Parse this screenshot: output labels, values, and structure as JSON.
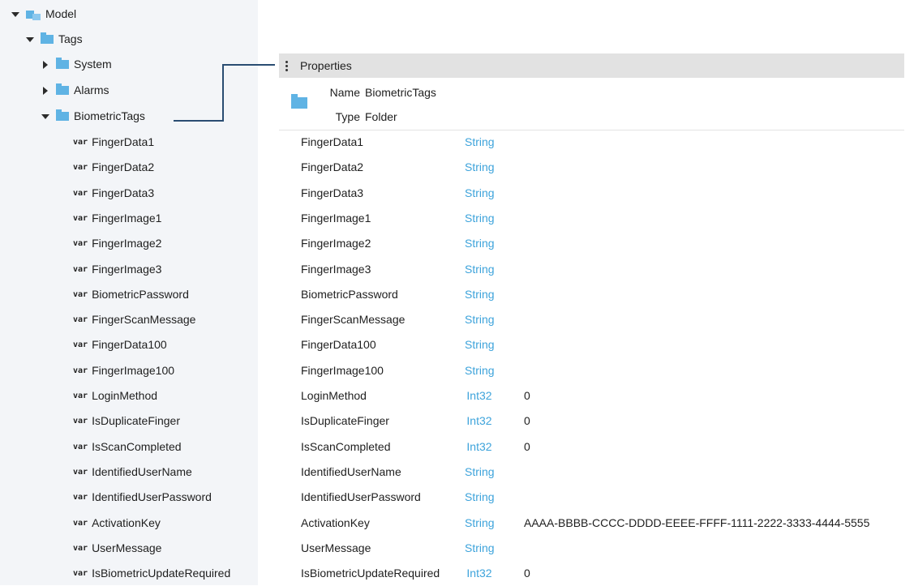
{
  "tree": {
    "model_label": "Model",
    "tags_label": "Tags",
    "system_label": "System",
    "alarms_label": "Alarms",
    "biometric_label": "BiometricTags",
    "var_prefix": "var",
    "variables": [
      "FingerData1",
      "FingerData2",
      "FingerData3",
      "FingerImage1",
      "FingerImage2",
      "FingerImage3",
      "BiometricPassword",
      "FingerScanMessage",
      "FingerData100",
      "FingerImage100",
      "LoginMethod",
      "IsDuplicateFinger",
      "IsScanCompleted",
      "IdentifiedUserName",
      "IdentifiedUserPassword",
      "ActivationKey",
      "UserMessage",
      "IsBiometricUpdateRequired"
    ]
  },
  "properties": {
    "header_title": "Properties",
    "name_label": "Name",
    "name_value": "BiometricTags",
    "type_label": "Type",
    "type_value": "Folder",
    "rows": [
      {
        "name": "FingerData1",
        "type": "String",
        "value": ""
      },
      {
        "name": "FingerData2",
        "type": "String",
        "value": ""
      },
      {
        "name": "FingerData3",
        "type": "String",
        "value": ""
      },
      {
        "name": "FingerImage1",
        "type": "String",
        "value": ""
      },
      {
        "name": "FingerImage2",
        "type": "String",
        "value": ""
      },
      {
        "name": "FingerImage3",
        "type": "String",
        "value": ""
      },
      {
        "name": "BiometricPassword",
        "type": "String",
        "value": ""
      },
      {
        "name": "FingerScanMessage",
        "type": "String",
        "value": ""
      },
      {
        "name": "FingerData100",
        "type": "String",
        "value": ""
      },
      {
        "name": "FingerImage100",
        "type": "String",
        "value": ""
      },
      {
        "name": "LoginMethod",
        "type": "Int32",
        "value": "0"
      },
      {
        "name": "IsDuplicateFinger",
        "type": "Int32",
        "value": "0"
      },
      {
        "name": "IsScanCompleted",
        "type": "Int32",
        "value": "0"
      },
      {
        "name": "IdentifiedUserName",
        "type": "String",
        "value": ""
      },
      {
        "name": "IdentifiedUserPassword",
        "type": "String",
        "value": ""
      },
      {
        "name": "ActivationKey",
        "type": "String",
        "value": "AAAA-BBBB-CCCC-DDDD-EEEE-FFFF-1111-2222-3333-4444-5555"
      },
      {
        "name": "UserMessage",
        "type": "String",
        "value": ""
      },
      {
        "name": "IsBiometricUpdateRequired",
        "type": "Int32",
        "value": "0"
      }
    ]
  },
  "colors": {
    "accent": "#3da3db",
    "folder": "#5fb3e4",
    "connector": "#2a4d72",
    "tree_bg": "#f3f5f8",
    "header_bg": "#e2e2e2"
  }
}
